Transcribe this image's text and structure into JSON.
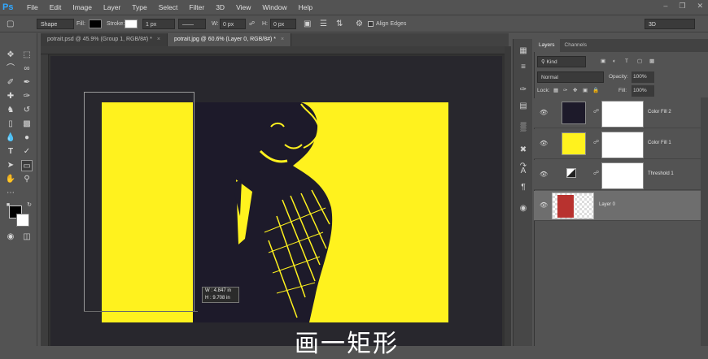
{
  "app": {
    "logo": "Ps",
    "menu": [
      "File",
      "Edit",
      "Image",
      "Layer",
      "Type",
      "Select",
      "Filter",
      "3D",
      "View",
      "Window",
      "Help"
    ],
    "window_controls": [
      "minimize-icon",
      "restore-icon",
      "close-icon"
    ]
  },
  "options_bar": {
    "mode": "Shape",
    "fill_label": "Fill:",
    "stroke_label": "Stroke:",
    "stroke_width": "1 px",
    "w_label": "W:",
    "w_value": "0 px",
    "h_label": "H:",
    "h_value": "0 px",
    "align_edges": "Align Edges",
    "workspace": "3D"
  },
  "tabs": [
    {
      "label": "potrait.psd @ 45.9% (Group 1, RGB/8#) *",
      "active": false
    },
    {
      "label": "potrait.jpg @ 60.6% (Layer 0, RGB/8#) *",
      "active": true
    }
  ],
  "canvas": {
    "measure_w": "W :    4.847 in",
    "measure_h": "H :    9.708 in",
    "caption": "画一矩形",
    "colors": {
      "yellow": "#fff21e",
      "dark": "#28272d"
    }
  },
  "layers_panel": {
    "tabs": [
      "Layers",
      "Channels"
    ],
    "kind_filter": "Kind",
    "blend_mode": "Normal",
    "opacity_label": "Opacity:",
    "opacity_value": "100%",
    "lock_label": "Lock:",
    "fill_label": "Fill:",
    "fill_value": "100%",
    "layers": [
      {
        "name": "Color Fill 2",
        "thumb_color": "#1d1a2a",
        "selected": false
      },
      {
        "name": "Color Fill 1",
        "thumb_color": "#fff21e",
        "selected": false
      },
      {
        "name": "Threshold 1",
        "thumb_color": "adjustment",
        "selected": false
      },
      {
        "name": "Layer 0",
        "thumb_color": "photo",
        "selected": true
      }
    ]
  }
}
